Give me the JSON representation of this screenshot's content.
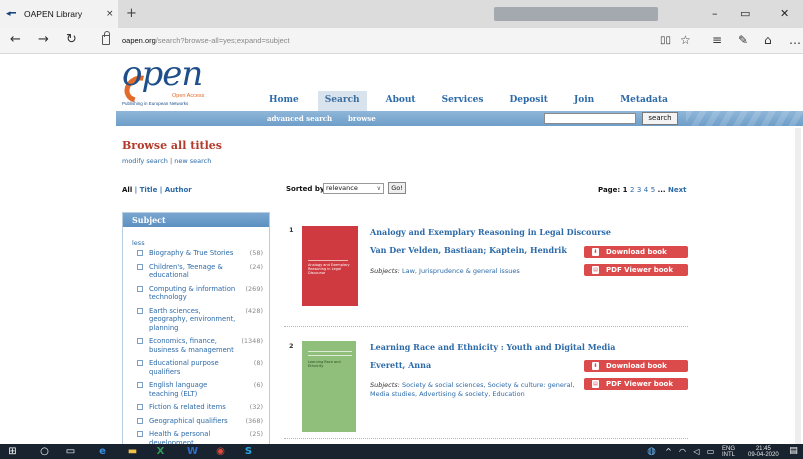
{
  "browser": {
    "tab_title": "OAPEN Library",
    "tab_close": "×",
    "new_tab": "+",
    "address_host": "oapen.org",
    "address_path": "/search?browse-all=yes;expand=subject",
    "win_min": "–",
    "win_max": "▭",
    "win_close": "✕"
  },
  "site": {
    "logo_word": "open",
    "logo_sub1": "Open Access",
    "logo_sub2": "Publishing in European Networks"
  },
  "nav": [
    "Home",
    "Search",
    "About",
    "Services",
    "Deposit",
    "Join",
    "Metadata"
  ],
  "subnav": {
    "advanced": "advanced search",
    "browse": "browse",
    "search_button": "search",
    "search_value": ""
  },
  "page": {
    "heading": "Browse all titles",
    "modify_search": "modify search",
    "new_search": "new search",
    "filter_all": "All",
    "filter_title": "Title",
    "filter_author": "Author",
    "sorted_by": "Sorted by:",
    "sort_value": "relevance",
    "go": "Go!",
    "page_label": "Page:",
    "pages": [
      "1",
      "2",
      "3",
      "4",
      "5"
    ],
    "ellipsis": "...",
    "next": "Next"
  },
  "sidebar": {
    "title": "Subject",
    "less": "less",
    "items": [
      {
        "label": "Biography & True Stories",
        "count": "(58)"
      },
      {
        "label": "Children's, Teenage & educational",
        "count": "(24)"
      },
      {
        "label": "Computing & information technology",
        "count": "(269)"
      },
      {
        "label": "Earth sciences, geography, environment, planning",
        "count": "(428)"
      },
      {
        "label": "Economics, finance, business & management",
        "count": "(1348)"
      },
      {
        "label": "Educational purpose qualifiers",
        "count": "(8)"
      },
      {
        "label": "English language teaching (ELT)",
        "count": "(6)"
      },
      {
        "label": "Fiction & related items",
        "count": "(32)"
      },
      {
        "label": "Geographical qualifiers",
        "count": "(368)"
      },
      {
        "label": "Health & personal development",
        "count": "(25)"
      }
    ]
  },
  "results": [
    {
      "num": "1",
      "title": "Analogy and Exemplary Reasoning in Legal Discourse",
      "authors": "Van Der Velden, Bastiaan; Kaptein, Hendrik",
      "subjects_label": "Subjects:",
      "subjects": "Law, Jurisprudence & general issues",
      "cover_text": "Analogy and Exemplary Reasoning in Legal Discourse",
      "download": "Download book",
      "viewer": "PDF Viewer book"
    },
    {
      "num": "2",
      "title": "Learning Race and Ethnicity : Youth and Digital Media",
      "authors": "Everett, Anna",
      "subjects_label": "Subjects:",
      "subjects": "Society & social sciences, Society & culture: general, Media studies, Advertising & society, Education",
      "cover_text": "Learning Race and Ethnicity",
      "download": "Download book",
      "viewer": "PDF Viewer book"
    }
  ],
  "taskbar": {
    "lang": "ENG",
    "lang2": "INTL",
    "time": "21:45",
    "date": "09-04-2020"
  }
}
